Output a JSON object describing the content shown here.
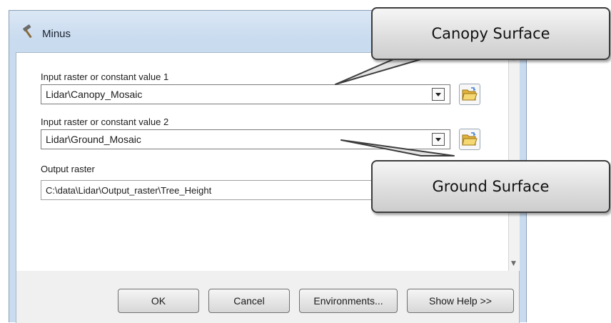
{
  "window": {
    "title": "Minus"
  },
  "form": {
    "input1": {
      "label": "Input raster or constant value 1",
      "value": "Lidar\\Canopy_Mosaic"
    },
    "input2": {
      "label": "Input raster or constant value 2",
      "value": "Lidar\\Ground_Mosaic"
    },
    "output": {
      "label": "Output raster",
      "value": "C:\\data\\Lidar\\Output_raster\\Tree_Height"
    }
  },
  "buttons": {
    "ok": "OK",
    "cancel": "Cancel",
    "environments": "Environments...",
    "show_help": "Show Help >>"
  },
  "callouts": {
    "canopy": "Canopy Surface",
    "ground": "Ground Surface"
  },
  "icons": {
    "title": "hammer-icon",
    "browse": "open-folder-icon",
    "dropdown": "chevron-down-icon"
  },
  "colors": {
    "folder": "#f2c94c",
    "title_bar": "#c9dbef"
  }
}
